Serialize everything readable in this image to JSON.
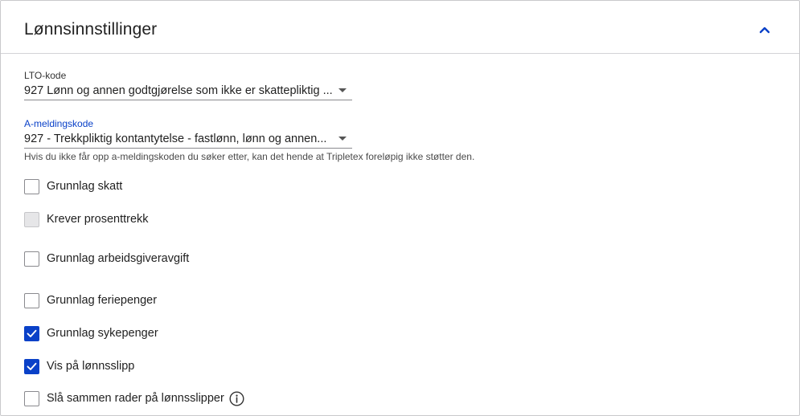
{
  "panel": {
    "title": "Lønnsinnstillinger",
    "collapse_icon": "chevron-up-icon"
  },
  "lto": {
    "label": "LTO-kode",
    "value": "927 Lønn og annen godtgjørelse som ikke er skattepliktig ..."
  },
  "a_melding": {
    "label": "A-meldingskode",
    "value": "927 - Trekkpliktig kontantytelse - fastlønn, lønn og annen...",
    "helper": "Hvis du ikke får opp a-meldingskoden du søker etter, kan det hende at Tripletex foreløpig ikke støtter den."
  },
  "checkboxes": [
    {
      "label": "Grunnlag skatt",
      "checked": false,
      "disabled": false
    },
    {
      "label": "Krever prosenttrekk",
      "checked": false,
      "disabled": true
    },
    {
      "label": "Grunnlag arbeidsgiveravgift",
      "checked": false,
      "disabled": false
    },
    {
      "label": "Grunnlag feriepenger",
      "checked": false,
      "disabled": false
    },
    {
      "label": "Grunnlag sykepenger",
      "checked": true,
      "disabled": false
    },
    {
      "label": "Vis på lønnsslipp",
      "checked": true,
      "disabled": false
    },
    {
      "label": "Slå sammen rader på lønnsslipper",
      "checked": false,
      "disabled": false,
      "info_icon": "info-icon"
    }
  ],
  "colors": {
    "accent": "#0a41c8",
    "border": "#c9c9cc"
  }
}
